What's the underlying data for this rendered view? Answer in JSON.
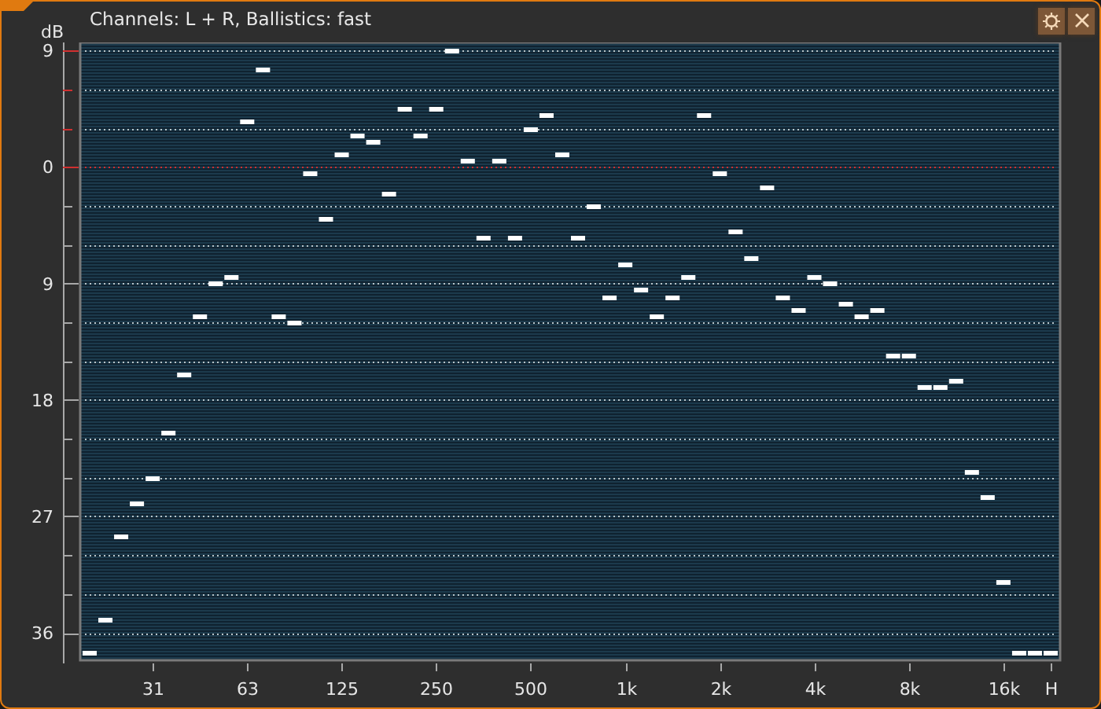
{
  "window": {
    "title": "Channels: L + R, Ballistics: fast",
    "buttons": [
      {
        "kind": "settings"
      },
      {
        "kind": "close"
      }
    ]
  },
  "analyzer": {
    "chart_data": {
      "type": "scatter",
      "ylabel": "dB",
      "grid": true,
      "ref_lines": [
        {
          "axis": "y",
          "value": 0,
          "color": "#d03030"
        }
      ],
      "ylim": [
        -38,
        9.5
      ],
      "yticks": [
        {
          "value": 9,
          "label": "9"
        },
        {
          "value": 0,
          "label": "0"
        },
        {
          "value": -9,
          "label": "9"
        },
        {
          "value": -18,
          "label": "18"
        },
        {
          "value": -27,
          "label": "27"
        },
        {
          "value": -36,
          "label": "36"
        }
      ],
      "categories": [
        null,
        null,
        null,
        null,
        "31",
        null,
        null,
        null,
        null,
        null,
        "63",
        null,
        null,
        null,
        null,
        null,
        "125",
        null,
        null,
        null,
        null,
        null,
        "250",
        null,
        null,
        null,
        null,
        null,
        "500",
        null,
        null,
        null,
        null,
        null,
        "1k",
        null,
        null,
        null,
        null,
        null,
        "2k",
        null,
        null,
        null,
        null,
        null,
        "4k",
        null,
        null,
        null,
        null,
        null,
        "8k",
        null,
        null,
        null,
        null,
        null,
        "16k",
        null,
        null,
        "H"
      ],
      "series": [
        {
          "color": "#ffffff",
          "values": [
            -37.5,
            -35,
            -28.5,
            -26,
            -24,
            -20.5,
            -16,
            -11.5,
            -9,
            -8.5,
            3.5,
            7.5,
            -11.5,
            -12,
            -0.5,
            -4,
            1,
            2.5,
            2,
            -2,
            4.5,
            2.5,
            4.5,
            9,
            0.5,
            -5.5,
            0.5,
            -5.5,
            3,
            4,
            1,
            -5.5,
            -3,
            -10,
            -7.5,
            -9.5,
            -11.5,
            -10,
            -8.5,
            4,
            -0.5,
            -5,
            -7,
            -1.5,
            -10,
            -11,
            -8.5,
            -9,
            -10.5,
            -11.5,
            -11,
            -14.5,
            -14.5,
            -17,
            -17,
            -16.5,
            -23.5,
            -25.5,
            -32,
            -37.5,
            -37.5,
            -37.5
          ]
        }
      ]
    }
  }
}
